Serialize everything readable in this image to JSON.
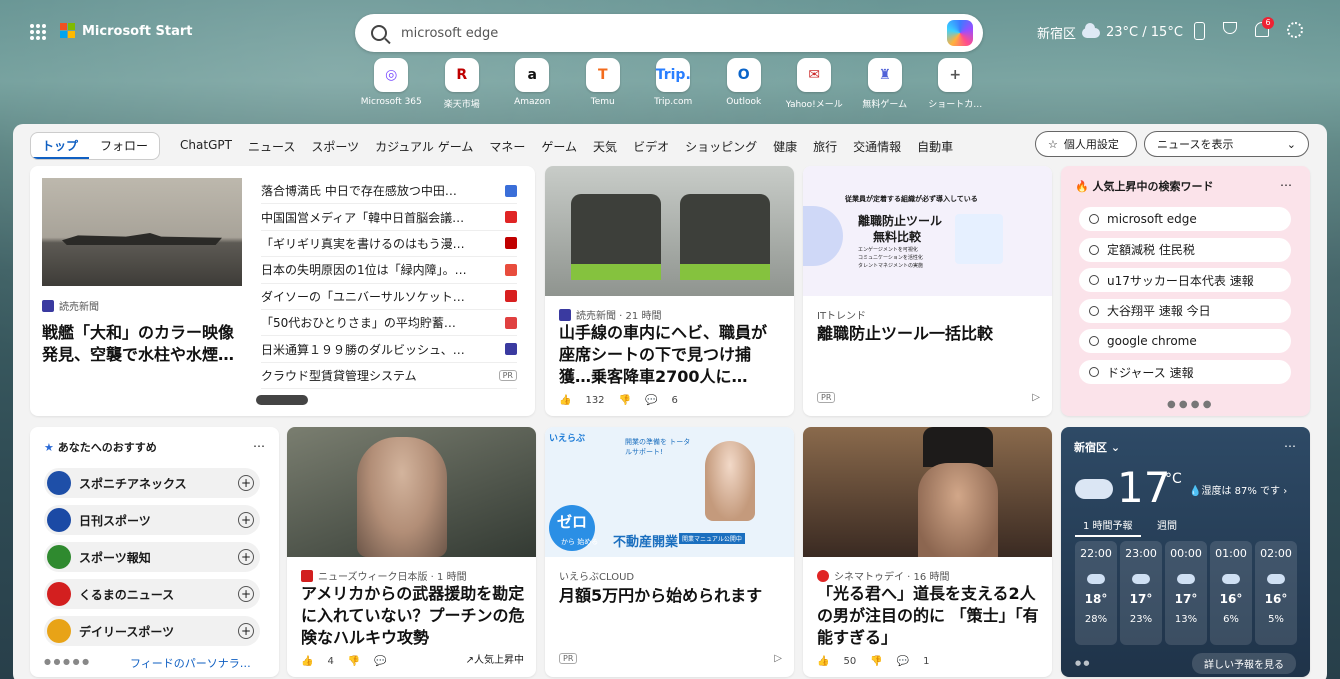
{
  "header": {
    "brand": "Microsoft Start",
    "search_text": "microsoft edge",
    "location": "新宿区",
    "temp": "23°C / 15°C",
    "notification_count": "6"
  },
  "quicklinks": [
    {
      "label": "Microsoft 365",
      "icon": "◎",
      "color": "#7b4dff"
    },
    {
      "label": "楽天市場",
      "icon": "R",
      "color": "#bf0000"
    },
    {
      "label": "Amazon",
      "icon": "a",
      "color": "#111"
    },
    {
      "label": "Temu",
      "icon": "T",
      "color": "#f36b1c"
    },
    {
      "label": "Trip.com",
      "icon": "Trip.",
      "color": "#2a7fff"
    },
    {
      "label": "Outlook",
      "icon": "O",
      "color": "#0a64c9"
    },
    {
      "label": "Yahoo!メール",
      "icon": "✉",
      "color": "#cc2a2a"
    },
    {
      "label": "無料ゲーム",
      "icon": "♜",
      "color": "#5061d8"
    },
    {
      "label": "ショートカ…",
      "icon": "+",
      "color": "#555"
    }
  ],
  "nav": {
    "tab_top": "トップ",
    "tab_follow": "フォロー",
    "links": [
      "ChatGPT",
      "ニュース",
      "スポーツ",
      "カジュアル ゲーム",
      "マネー",
      "ゲーム",
      "天気",
      "ビデオ",
      "ショッピング",
      "健康",
      "旅行",
      "交通情報",
      "自動車"
    ],
    "personal": "個人用設定",
    "news_display": "ニュースを表示"
  },
  "feature": {
    "source": "読売新聞",
    "headline": "戦艦「大和」のカラー映像発見、空襲で水柱や水煙…",
    "list": [
      "落合博満氏 中日で存在感放つ中田…",
      "中国国営メディア「韓中日首脳会議…",
      "「ギリギリ真実を書けるのはもう漫…",
      "日本の失明原因の1位は「緑内障」。…",
      "ダイソーの「ユニバーサルソケット…",
      "「50代おひとりさま」の平均貯蓄…",
      "日米通算１９９勝のダルビッシュ、…",
      "クラウド型賃貸管理システム"
    ],
    "pr": "PR"
  },
  "card2": {
    "source": "読売新聞 · 21 時間",
    "headline": "山手線の車内にヘビ、職員が座席シートの下で見つけ捕獲…乗客降車2700人に…",
    "likes": "132",
    "comments": "6"
  },
  "card3": {
    "source": "ITトレンド",
    "headline": "離職防止ツール一括比較",
    "pr": "PR",
    "ad_line1": "従業員が定着する組織が必ず導入している",
    "ad_line2": "離職防止ツール",
    "ad_line3": "無料比較",
    "ad_bullets": [
      "エンゲージメントを可視化",
      "コミュニケーションを活性化",
      "タレントマネジメントの実施"
    ]
  },
  "trending": {
    "title": "人気上昇中の検索ワード",
    "items": [
      "microsoft edge",
      "定額減税 住民税",
      "u17サッカー日本代表 速報",
      "大谷翔平 速報 今日",
      "google chrome",
      "ドジャース 速報"
    ]
  },
  "recommend": {
    "title": "あなたへのおすすめ",
    "items": [
      "スポニチアネックス",
      "日刊スポーツ",
      "スポーツ報知",
      "くるまのニュース",
      "デイリースポーツ"
    ],
    "more": "フィードのパーソナラ…"
  },
  "card4": {
    "source": "ニューズウィーク日本版 · 1 時間",
    "headline": "アメリカからの武器援助を勘定に入れていない？プーチンの危険なハルキウ攻勢",
    "likes": "4",
    "trend": "人気上昇中"
  },
  "card5": {
    "source": "いえらぶCLOUD",
    "headline": "月額5万円から始められます",
    "pr": "PR",
    "ad_big": "ゼロ",
    "ad_sub": "から 始める",
    "ad_main": "不動産開業",
    "ad_note": "開業マニュアル公開中",
    "ad_logo": "いえらぶ",
    "ad_bubble": "開業の準備を トータルサポート!"
  },
  "card6": {
    "source": "シネマトゥデイ · 16 時間",
    "headline": "「光る君へ」道長を支える2人の男が注目の的に 「策士」「有能すぎる」",
    "likes": "50",
    "comments": "1"
  },
  "weather": {
    "location": "新宿区",
    "temp": "17",
    "unit": "°C",
    "humidity": "湿度は 87% です",
    "tab1": "1 時間予報",
    "tab2": "週間",
    "more": "詳しい予報を見る",
    "hours": [
      {
        "h": "22:00",
        "t": "18°",
        "p": "28%"
      },
      {
        "h": "23:00",
        "t": "17°",
        "p": "23%"
      },
      {
        "h": "00:00",
        "t": "17°",
        "p": "13%"
      },
      {
        "h": "01:00",
        "t": "16°",
        "p": "6%"
      },
      {
        "h": "02:00",
        "t": "16°",
        "p": "5%"
      }
    ]
  }
}
